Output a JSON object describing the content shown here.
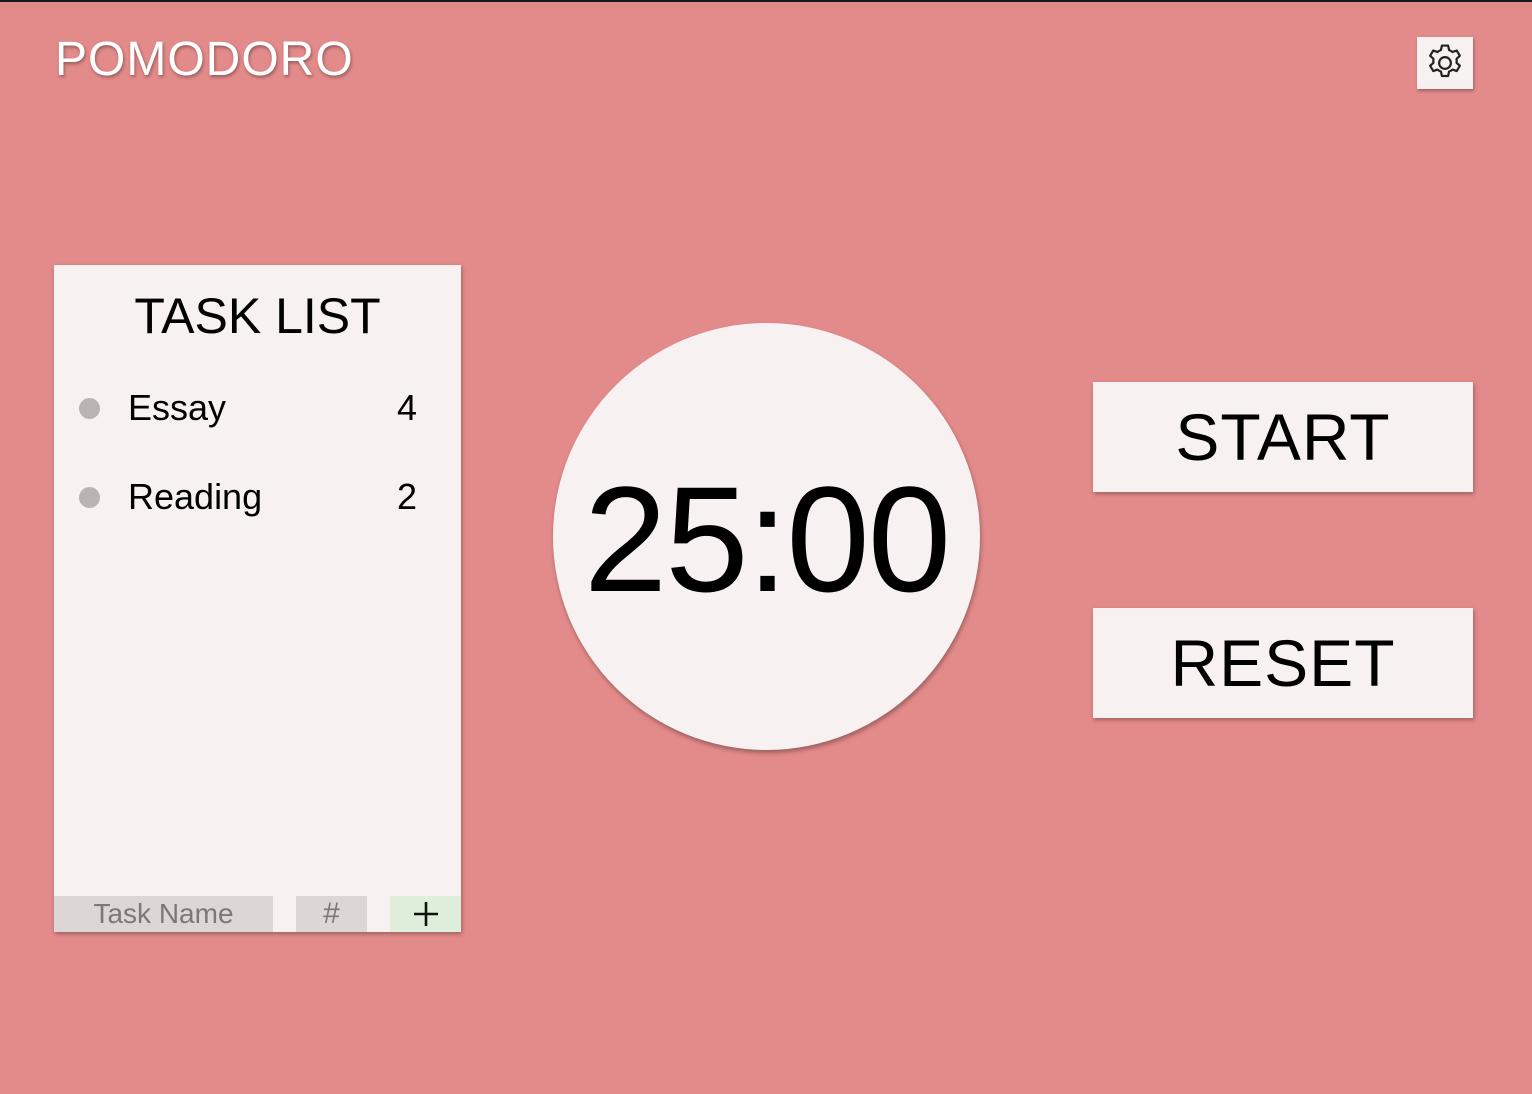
{
  "app": {
    "title": "POMODORO",
    "settings_icon": "gear-icon"
  },
  "task_list": {
    "title": "TASK LIST",
    "items": [
      {
        "name": "Essay",
        "count": "4"
      },
      {
        "name": "Reading",
        "count": "2"
      }
    ],
    "new_task": {
      "name_placeholder": "Task Name",
      "name_value": "",
      "count_placeholder": "#",
      "count_value": "",
      "add_icon": "plus-icon"
    }
  },
  "timer": {
    "display": "25:00"
  },
  "controls": {
    "start_label": "START",
    "reset_label": "RESET"
  },
  "colors": {
    "background": "#e38a8a",
    "panel": "#f7f1f1",
    "input": "#dcd6d6",
    "add_button": "#dfeddb",
    "bullet": "#bab3b3"
  }
}
